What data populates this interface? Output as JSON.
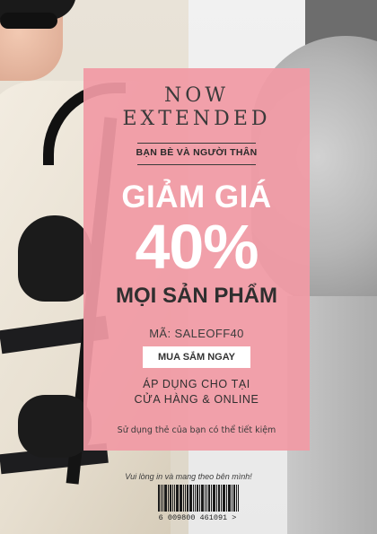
{
  "poster": {
    "line1": "NOW",
    "line2": "EXTENDED",
    "audience": "BẠN BÈ VÀ NGƯỜI THÂN",
    "discount_label": "GIẢM GIÁ",
    "discount_value": "40%",
    "scope": "MỌI SẢN PHẨM",
    "promo_code": "MÃ: SALEOFF40",
    "cta_label": "MUA SẮM NGAY",
    "apply_line1": "ÁP DỤNG CHO TẠI",
    "apply_line2": "CỬA HÀNG & ONLINE",
    "save_note": "Sử dụng thẻ của bạn có thể tiết kiệm"
  },
  "footer": {
    "print_note": "Vui lòng in và mang theo bên mình!",
    "barcode_number": "6 009800 461091 >"
  },
  "colors": {
    "panel": "#f19aa5",
    "headline": "#ffffff",
    "text": "#2f2f2f"
  }
}
